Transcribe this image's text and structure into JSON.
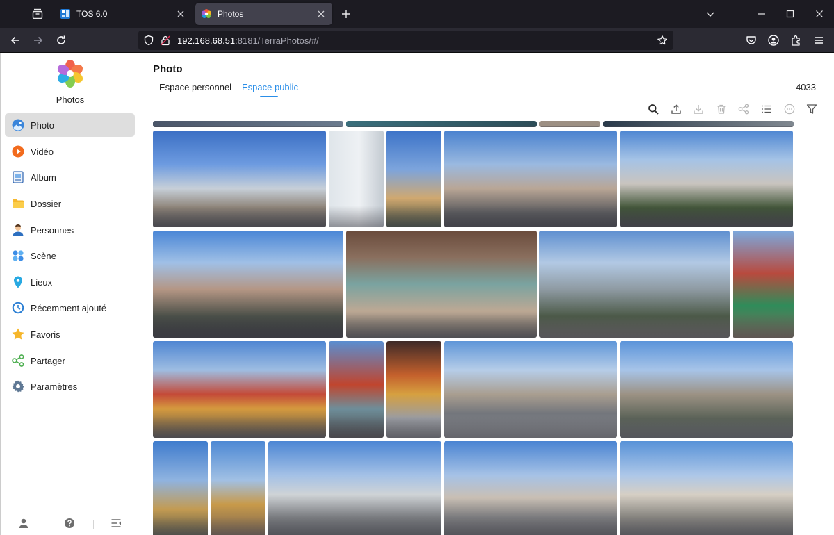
{
  "browser": {
    "tabs": [
      {
        "title": "TOS 6.0",
        "active": false,
        "favicon": "tos-favicon-icon"
      },
      {
        "title": "Photos",
        "active": true,
        "favicon": "photos-favicon-icon"
      }
    ],
    "url": {
      "host": "192.168.68.51",
      "rest": ":8181/TerraPhotos/#/"
    }
  },
  "app": {
    "name": "Photos",
    "colors": {
      "accent": "#2a8ee8",
      "active_nav_bg": "#dedede"
    }
  },
  "sidebar": {
    "items": [
      {
        "label": "Photo",
        "icon": "photo-icon",
        "active": true
      },
      {
        "label": "Vidéo",
        "icon": "video-icon"
      },
      {
        "label": "Album",
        "icon": "album-icon"
      },
      {
        "label": "Dossier",
        "icon": "folder-icon"
      },
      {
        "label": "Personnes",
        "icon": "person-icon"
      },
      {
        "label": "Scène",
        "icon": "scene-icon"
      },
      {
        "label": "Lieux",
        "icon": "location-pin-icon"
      },
      {
        "label": "Récemment ajouté",
        "icon": "clock-icon"
      },
      {
        "label": "Favoris",
        "icon": "star-icon"
      },
      {
        "label": "Partager",
        "icon": "share-icon"
      },
      {
        "label": "Paramètres",
        "icon": "gear-icon"
      }
    ],
    "footer": [
      "user-icon",
      "help-icon",
      "collapse-menu-icon"
    ]
  },
  "main": {
    "title": "Photo",
    "tabs": [
      {
        "label": "Espace personnel",
        "active": false
      },
      {
        "label": "Espace public",
        "active": true
      }
    ],
    "count": "4033",
    "toolbar": [
      {
        "icon": "search-icon",
        "enabled": true
      },
      {
        "icon": "upload-icon",
        "enabled": true
      },
      {
        "icon": "download-icon",
        "enabled": false
      },
      {
        "icon": "trash-icon",
        "enabled": false
      },
      {
        "icon": "share-icon",
        "enabled": false
      },
      {
        "icon": "list-view-icon",
        "enabled": true
      },
      {
        "icon": "more-icon",
        "enabled": false
      },
      {
        "icon": "filter-icon",
        "enabled": true
      }
    ]
  }
}
